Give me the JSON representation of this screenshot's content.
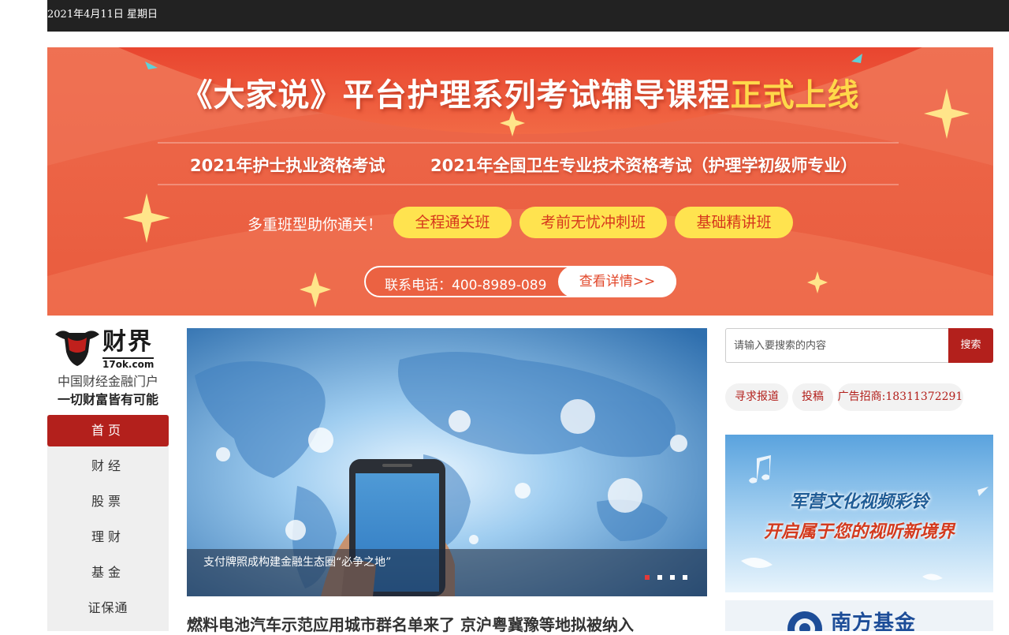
{
  "topbar": {
    "date": "2021年4月11日 星期日"
  },
  "banner": {
    "title_main": "《大家说》平台护理系列考试辅导课程",
    "title_highlight": "正式上线",
    "subtitle_1": "2021年护士执业资格考试",
    "subtitle_2": "2021年全国卫生专业技术资格考试（护理学初级师专业）",
    "lead": "多重班型助你通关！",
    "classes": [
      "全程通关班",
      "考前无忧冲刺班",
      "基础精讲班"
    ],
    "contact": "联系电话：400-8989-089",
    "details_button": "查看详情>>"
  },
  "logo": {
    "brand": "财界",
    "domain": "17ok.com",
    "tagline_1": "中国财经金融门户",
    "tagline_2": "一切财富皆有可能"
  },
  "nav": {
    "items": [
      {
        "label": "首页",
        "active": true
      },
      {
        "label": "财经",
        "active": false
      },
      {
        "label": "股票",
        "active": false
      },
      {
        "label": "理财",
        "active": false
      },
      {
        "label": "基金",
        "active": false
      },
      {
        "label": "证保通",
        "active": false
      }
    ]
  },
  "slider": {
    "caption": "支付牌照成构建金融生态圈“必争之地”",
    "dots": 4,
    "active_dot": 0
  },
  "headline": "燃料电池汽车示范应用城市群名单来了 京沪粤冀豫等地拟被纳入",
  "search": {
    "placeholder": "请输入要搜索的内容",
    "button": "搜索"
  },
  "tags": [
    "寻求报道",
    "投稿",
    "广告招商:18311372291"
  ],
  "ads": {
    "ad1_line1": "军营文化视频彩铃",
    "ad1_line2": "开启属于您的视听新境界",
    "ad2_name": "南方基金"
  },
  "colors": {
    "brand_red": "#b3201c",
    "banner_orange": "#ef6a4e",
    "banner_yellow": "#ffe34f",
    "topbar": "#222222"
  }
}
